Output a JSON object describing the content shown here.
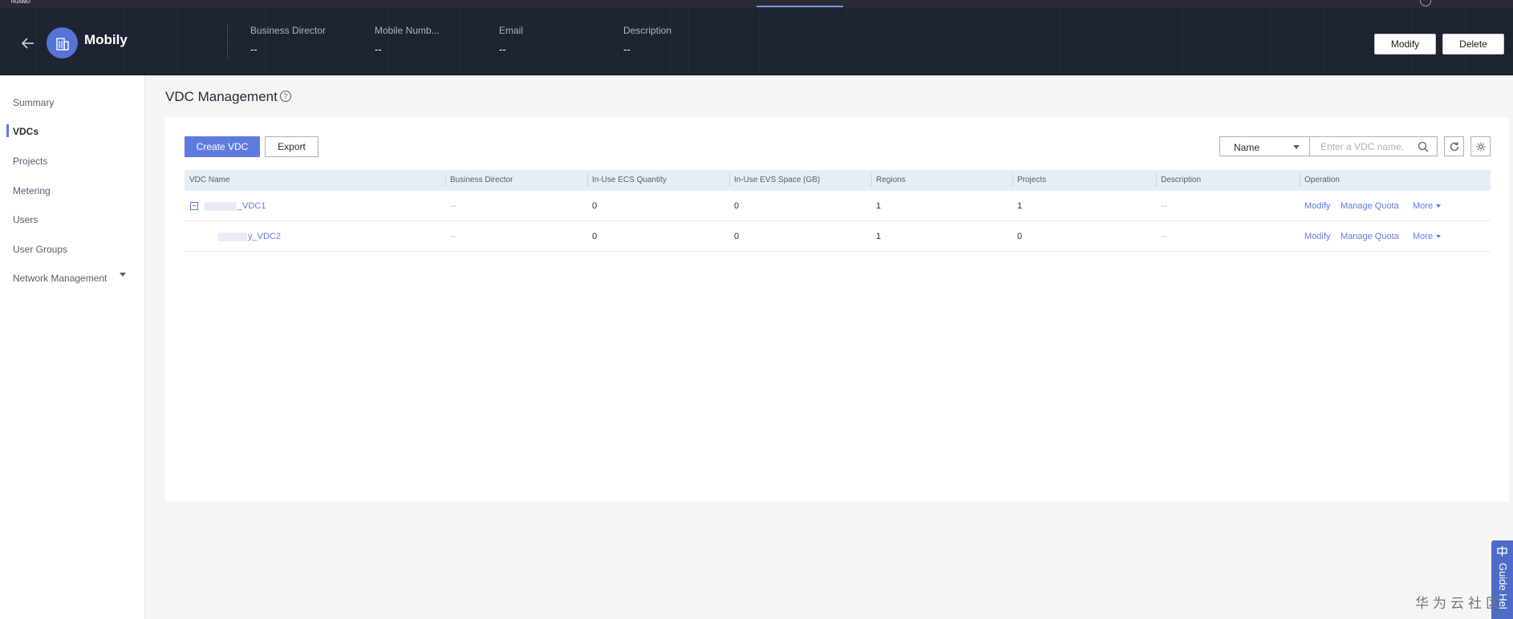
{
  "topbar": {
    "brand": "HUAWEI"
  },
  "header": {
    "tenant_name": "Mobily",
    "info": [
      {
        "label": "Business Director",
        "value": "--"
      },
      {
        "label": "Mobile Numb...",
        "value": "--"
      },
      {
        "label": "Email",
        "value": "--"
      },
      {
        "label": "Description",
        "value": "--"
      }
    ],
    "modify_label": "Modify",
    "delete_label": "Delete"
  },
  "sidebar": {
    "items": [
      {
        "label": "Summary"
      },
      {
        "label": "VDCs",
        "active": true
      },
      {
        "label": "Projects"
      },
      {
        "label": "Metering"
      },
      {
        "label": "Users"
      },
      {
        "label": "User Groups"
      },
      {
        "label": "Network Management"
      }
    ]
  },
  "main": {
    "title": "VDC Management",
    "help_icon": "?",
    "toolbar": {
      "create_label": "Create VDC",
      "export_label": "Export",
      "filter_selected": "Name",
      "search_placeholder": "Enter a VDC name."
    },
    "table": {
      "columns": [
        "VDC Name",
        "Business Director",
        "In-Use ECS Quantity",
        "In-Use EVS Space (GB)",
        "Regions",
        "Projects",
        "Description",
        "Operation"
      ],
      "rows": [
        {
          "name": "_VDC1",
          "business_director": "--",
          "ecs": "0",
          "evs": "0",
          "regions": "1",
          "projects": "1",
          "description": "--",
          "ops": [
            "Modify",
            "Manage Quota",
            "More"
          ]
        },
        {
          "name": "y_VDC2",
          "business_director": "--",
          "ecs": "0",
          "evs": "0",
          "regions": "1",
          "projects": "0",
          "description": "--",
          "ops": [
            "Modify",
            "Manage Quota",
            "More"
          ]
        }
      ]
    }
  },
  "guide": {
    "label": "Guide Hel"
  },
  "watermark": "华为云社区",
  "colors": {
    "accent": "#5e7ce0",
    "header_bg": "#1d2330",
    "table_header_bg": "#e6edf7"
  }
}
